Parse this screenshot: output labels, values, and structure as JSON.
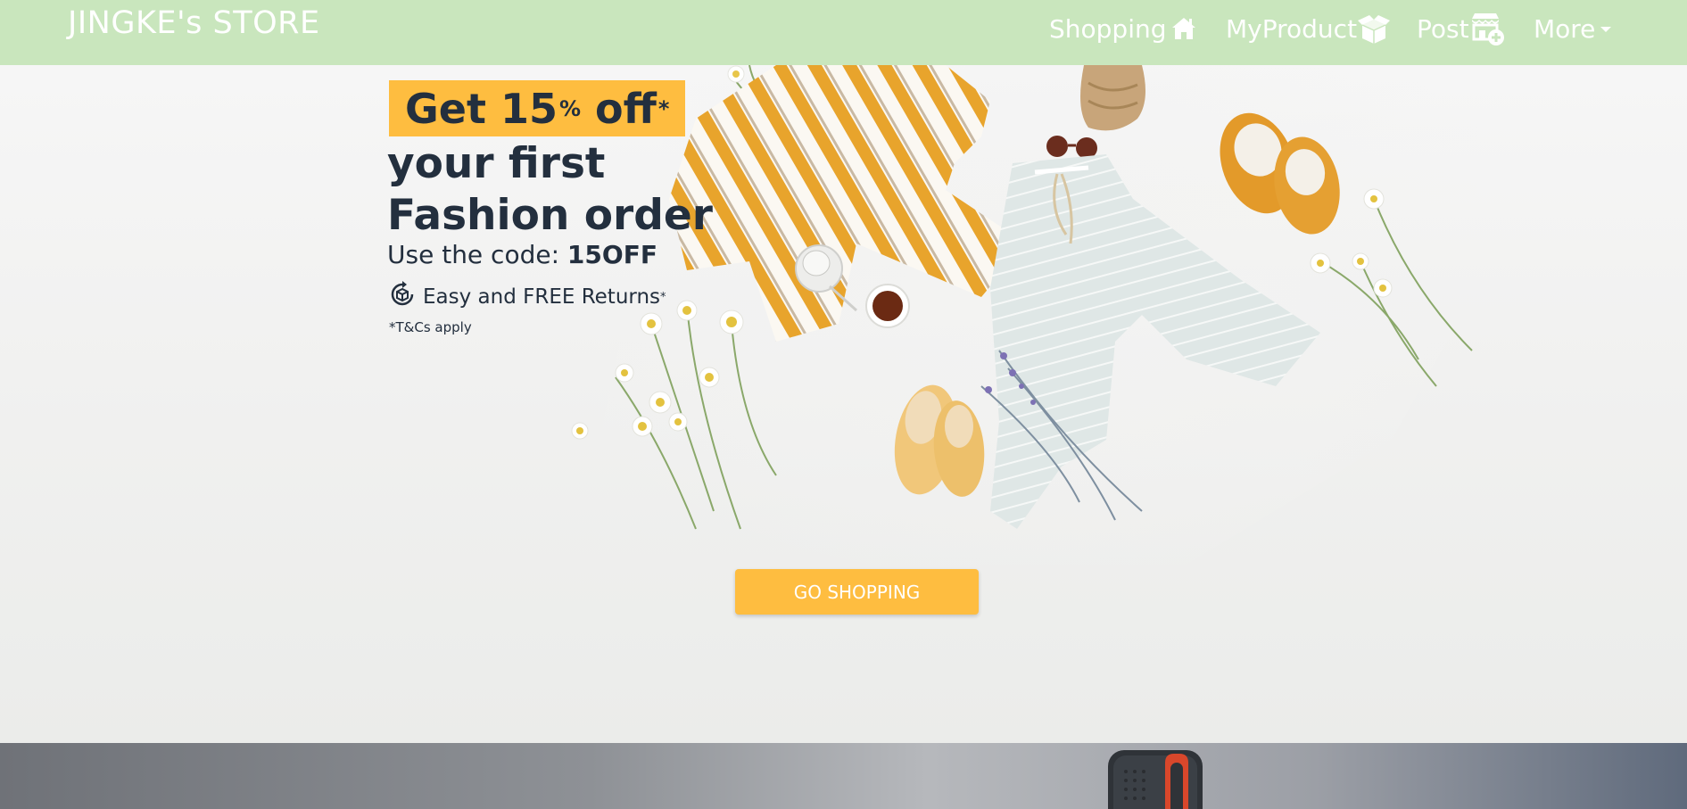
{
  "navbar": {
    "brand": "JINGKE's STORE",
    "items": [
      {
        "label": "Shopping",
        "icon": "home-icon"
      },
      {
        "label": "MyProduct",
        "icon": "package-icon"
      },
      {
        "label": "Post",
        "icon": "store-add-icon"
      },
      {
        "label": "More",
        "icon": "caret-down-icon"
      }
    ],
    "background_color": "#c9e6bd"
  },
  "hero": {
    "badge_text": "Get 15",
    "badge_percent": "%",
    "badge_suffix": " off",
    "badge_asterisk": "*",
    "headline": "your first Fashion order",
    "code_prefix": "Use the code: ",
    "code": "15OFF",
    "returns_text": "Easy and FREE Returns",
    "returns_asterisk": "*",
    "terms": "*T&Cs apply",
    "cta_label": "GO SHOPPING",
    "accent_color": "#febd40",
    "text_color": "#232f3e"
  },
  "banner2": {
    "image": "portable-ssd-product"
  }
}
